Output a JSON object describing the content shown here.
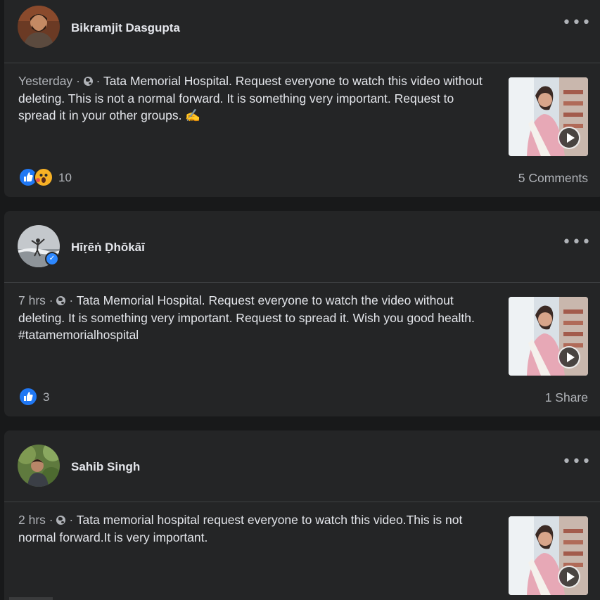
{
  "posts": [
    {
      "author": "Bikramjit Dasgupta",
      "verified": false,
      "time": "Yesterday",
      "separator_1": "·",
      "separator_2": "·",
      "text": "Tata Memorial Hospital. Request everyone to watch this video without deleting. This is not a normal forward. It is something very important. Request to spread it in your other groups.",
      "emoji": "✍️",
      "reaction_types": [
        "like",
        "wow"
      ],
      "reaction_count": "10",
      "footer_right": "5 Comments"
    },
    {
      "author": "Hīṛēṅ Ḍhōkāī",
      "verified": true,
      "time": "7 hrs",
      "separator_1": "·",
      "separator_2": "·",
      "text": "Tata Memorial Hospital. Request everyone to watch the video without deleting. It is something very important. Request to spread it. Wish you good health. #tatamemorialhospital",
      "emoji": "",
      "reaction_types": [
        "like"
      ],
      "reaction_count": "3",
      "footer_right": "1 Share"
    },
    {
      "author": "Sahib Singh",
      "verified": false,
      "time": "2 hrs",
      "separator_1": "·",
      "separator_2": "·",
      "text": "Tata memorial hospital request everyone to watch this video.This is not normal forward.It is very important.",
      "emoji": "",
      "reaction_types": [],
      "reaction_count": "",
      "footer_right": ""
    }
  ],
  "icons": {
    "more": "more-options-icon",
    "privacy": "globe-icon",
    "play": "play-icon",
    "like": "like-icon",
    "wow": "wow-icon"
  },
  "colors": {
    "page_background": "#18191a",
    "card_background": "#242526",
    "primary_text": "#e4e6eb",
    "secondary_text": "#b0b3b8",
    "like_blue": "#2078f4",
    "wow_yellow": "#f7b125"
  }
}
